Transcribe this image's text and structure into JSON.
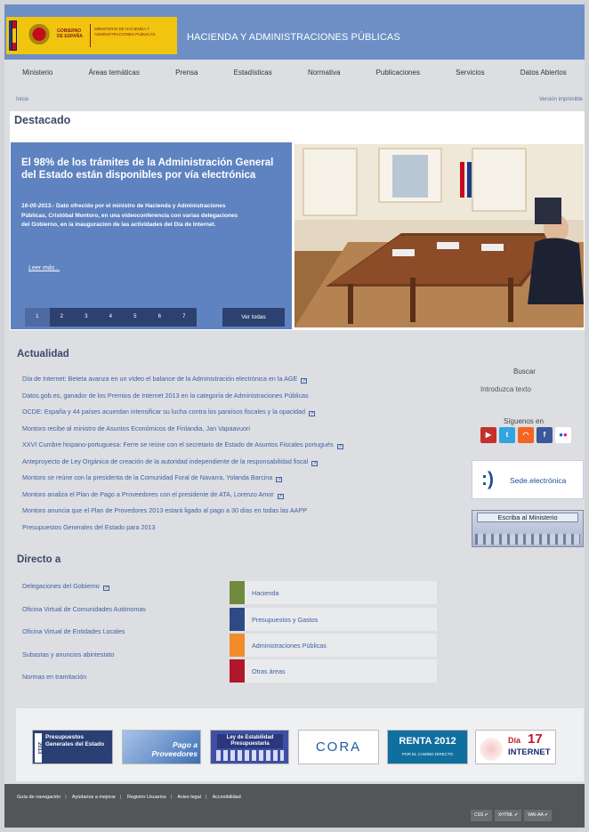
{
  "header": {
    "gobierno": "GOBIERNO DE ESPAÑA",
    "ministerio": "MINISTERIO DE HACIENDA Y ADMINISTRACIONES PÚBLICAS",
    "title": "HACIENDA Y ADMINISTRACIONES PÚBLICAS"
  },
  "nav": [
    "Ministerio",
    "Áreas temáticas",
    "Prensa",
    "Estadísticas",
    "Normativa",
    "Publicaciones",
    "Servicios",
    "Datos Abiertos"
  ],
  "breadcrumb": "Inicio",
  "print_version": "Versión imprimible",
  "destacado": {
    "title": "Destacado",
    "headline": "El 98% de los trámites de la Administración General del Estado están disponibles por vía electrónica",
    "date": "16-05-2013.-",
    "body": " Dato ofrecido por el ministro de Hacienda y Administraciones Públicas, Cristóbal Montoro, en una videoconferencia con varias delegaciones del Gobierno, en la inauguracion de las actividades del Día de Internet.",
    "more": "Leer más...",
    "pages": [
      "1",
      "2",
      "3",
      "4",
      "5",
      "6",
      "7"
    ],
    "active_page": "1",
    "see_all": "Ver todas"
  },
  "actualidad": {
    "title": "Actualidad",
    "items": [
      "Día de Internet: Beteta avanza en un vídeo el balance de la Administración electrónica en la AGE",
      "Datos.gob.es, ganador de los Premios de Internet 2013 en la categoría de Administraciones Públicas",
      "OCDE: España y 44 países acuerdan intensificar su lucha contra los paraísos fiscales y la opacidad",
      "Montoro recibe al ministro de Asuntos Económicos de Finlandia, Jan Vapaavuori",
      "XXVI Cumbre hispano-portuguesa: Ferre se reúne con el secretario de Estado de Asuntos Fiscales portugués",
      "Anteproyecto de Ley Orgánica de creación de la autoridad independiente de la responsabilidad fiscal",
      "Montoro se reúne con la presidenta de la Comunidad Foral de Navarra, Yolanda Barcina",
      "Montoro analiza el Plan de Pago a Proveedores con el presidente de ATA, Lorenzo Amor",
      "Montoro anuncia que el Plan de Provedores 2013 estará ligado al pago a 30 días en todas las AAPP",
      "Presupuestos Generales del Estado para 2013"
    ]
  },
  "sidebar": {
    "buscar": "Buscar",
    "search_text": "Introduzca texto",
    "siguenos": "Síguenos en",
    "social": [
      "YouTube",
      "Twitter",
      "RSS",
      "Facebook",
      "Flickr"
    ],
    "sede": "Sede.electrónica",
    "escriba": "Escriba al Ministerio"
  },
  "directo": {
    "title": "Directo a",
    "links": [
      "Delegaciones del Gobierno",
      "Oficina Virtual de Comunidades Autónomas",
      "Oficina Virtual de Entidades Locales",
      "Subastas y anuncios abintestato",
      "Normas en tramitación"
    ],
    "categories": [
      {
        "label": "Hacienda",
        "color": "#6f8a3a"
      },
      {
        "label": "Presupuestos y Gastos",
        "color": "#2d4a86"
      },
      {
        "label": "Administraciones Públicas",
        "color": "#f08c2a"
      },
      {
        "label": "Otras áreas",
        "color": "#b0172a"
      }
    ]
  },
  "banners": {
    "pge": "Presupuestos Generales del Estado",
    "pge_year": "2013",
    "pago": "Pago a Proveedores",
    "ley": "Ley de Estabilidad Presupuestaria",
    "cora": "CORA",
    "renta": "RENTA 2012",
    "renta_sub": "POR EL CAMINO DIRECTO",
    "dia_a": "Día",
    "dia_b": "17",
    "dia_c": "INTERNET"
  },
  "footer": {
    "links": [
      "Guía de navegación",
      "Ayúdanos a mejorar",
      "Registro Usuarios",
      "Aviso legal",
      "Accesibilidad"
    ],
    "badges": [
      "CSS ✔",
      "XHTML ✔",
      "WAI-AA ✔"
    ]
  }
}
